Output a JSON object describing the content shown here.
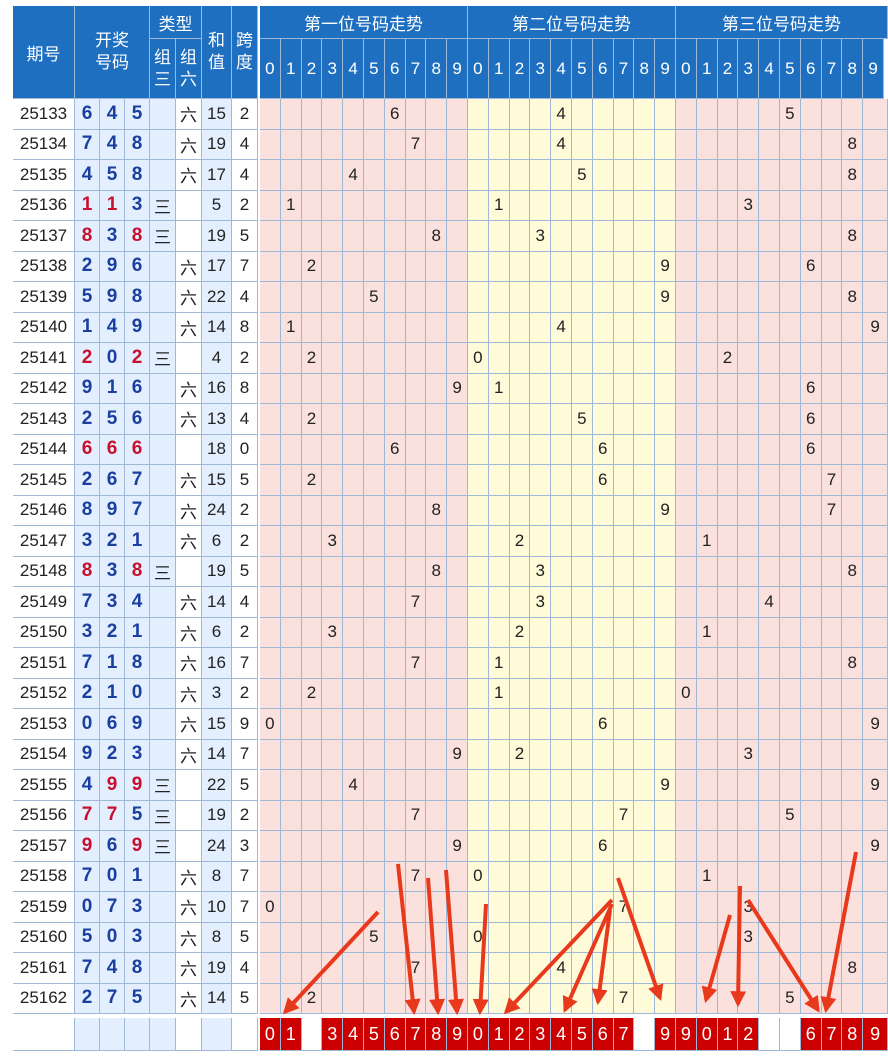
{
  "header": {
    "issue": "期号",
    "win_line1": "开奖",
    "win_line2": "号码",
    "type": "类型",
    "type_zu3_1": "组",
    "type_zu3_2": "三",
    "type_zu6_1": "组",
    "type_zu6_2": "六",
    "sum_1": "和",
    "sum_2": "值",
    "span_1": "跨",
    "span_2": "度",
    "pos1": "第一位号码走势",
    "pos2": "第二位号码走势",
    "pos3": "第三位号码走势",
    "digits": [
      "0",
      "1",
      "2",
      "3",
      "4",
      "5",
      "6",
      "7",
      "8",
      "9"
    ]
  },
  "colors": {
    "header_blue": "#1e6fbf",
    "number_blue": "#1b3fa0",
    "number_red": "#c8102e",
    "zone_pink": "#fbe1dd",
    "zone_yellow": "#fffbd9",
    "footer_red": "#cc0000",
    "arrow_red": "#e8391d"
  },
  "chart_data": {
    "type": "table",
    "columns": [
      "期号",
      "开奖号码",
      "组三",
      "组六",
      "和值",
      "跨度"
    ],
    "rows": [
      {
        "issue": "25133",
        "nums": [
          6,
          4,
          5
        ],
        "z3": "",
        "z6": "六",
        "sum": 15,
        "span": 2
      },
      {
        "issue": "25134",
        "nums": [
          7,
          4,
          8
        ],
        "z3": "",
        "z6": "六",
        "sum": 19,
        "span": 4
      },
      {
        "issue": "25135",
        "nums": [
          4,
          5,
          8
        ],
        "z3": "",
        "z6": "六",
        "sum": 17,
        "span": 4
      },
      {
        "issue": "25136",
        "nums": [
          1,
          1,
          3
        ],
        "z3": "三",
        "z6": "",
        "sum": 5,
        "span": 2
      },
      {
        "issue": "25137",
        "nums": [
          8,
          3,
          8
        ],
        "z3": "三",
        "z6": "",
        "sum": 19,
        "span": 5
      },
      {
        "issue": "25138",
        "nums": [
          2,
          9,
          6
        ],
        "z3": "",
        "z6": "六",
        "sum": 17,
        "span": 7
      },
      {
        "issue": "25139",
        "nums": [
          5,
          9,
          8
        ],
        "z3": "",
        "z6": "六",
        "sum": 22,
        "span": 4
      },
      {
        "issue": "25140",
        "nums": [
          1,
          4,
          9
        ],
        "z3": "",
        "z6": "六",
        "sum": 14,
        "span": 8
      },
      {
        "issue": "25141",
        "nums": [
          2,
          0,
          2
        ],
        "z3": "三",
        "z6": "",
        "sum": 4,
        "span": 2
      },
      {
        "issue": "25142",
        "nums": [
          9,
          1,
          6
        ],
        "z3": "",
        "z6": "六",
        "sum": 16,
        "span": 8
      },
      {
        "issue": "25143",
        "nums": [
          2,
          5,
          6
        ],
        "z3": "",
        "z6": "六",
        "sum": 13,
        "span": 4
      },
      {
        "issue": "25144",
        "nums": [
          6,
          6,
          6
        ],
        "z3": "",
        "z6": "",
        "sum": 18,
        "span": 0
      },
      {
        "issue": "25145",
        "nums": [
          2,
          6,
          7
        ],
        "z3": "",
        "z6": "六",
        "sum": 15,
        "span": 5
      },
      {
        "issue": "25146",
        "nums": [
          8,
          9,
          7
        ],
        "z3": "",
        "z6": "六",
        "sum": 24,
        "span": 2
      },
      {
        "issue": "25147",
        "nums": [
          3,
          2,
          1
        ],
        "z3": "",
        "z6": "六",
        "sum": 6,
        "span": 2
      },
      {
        "issue": "25148",
        "nums": [
          8,
          3,
          8
        ],
        "z3": "三",
        "z6": "",
        "sum": 19,
        "span": 5
      },
      {
        "issue": "25149",
        "nums": [
          7,
          3,
          4
        ],
        "z3": "",
        "z6": "六",
        "sum": 14,
        "span": 4
      },
      {
        "issue": "25150",
        "nums": [
          3,
          2,
          1
        ],
        "z3": "",
        "z6": "六",
        "sum": 6,
        "span": 2
      },
      {
        "issue": "25151",
        "nums": [
          7,
          1,
          8
        ],
        "z3": "",
        "z6": "六",
        "sum": 16,
        "span": 7
      },
      {
        "issue": "25152",
        "nums": [
          2,
          1,
          0
        ],
        "z3": "",
        "z6": "六",
        "sum": 3,
        "span": 2
      },
      {
        "issue": "25153",
        "nums": [
          0,
          6,
          9
        ],
        "z3": "",
        "z6": "六",
        "sum": 15,
        "span": 9
      },
      {
        "issue": "25154",
        "nums": [
          9,
          2,
          3
        ],
        "z3": "",
        "z6": "六",
        "sum": 14,
        "span": 7
      },
      {
        "issue": "25155",
        "nums": [
          4,
          9,
          9
        ],
        "z3": "三",
        "z6": "",
        "sum": 22,
        "span": 5
      },
      {
        "issue": "25156",
        "nums": [
          7,
          7,
          5
        ],
        "z3": "三",
        "z6": "",
        "sum": 19,
        "span": 2
      },
      {
        "issue": "25157",
        "nums": [
          9,
          6,
          9
        ],
        "z3": "三",
        "z6": "",
        "sum": 24,
        "span": 3
      },
      {
        "issue": "25158",
        "nums": [
          7,
          0,
          1
        ],
        "z3": "",
        "z6": "六",
        "sum": 8,
        "span": 7
      },
      {
        "issue": "25159",
        "nums": [
          0,
          7,
          3
        ],
        "z3": "",
        "z6": "六",
        "sum": 10,
        "span": 7
      },
      {
        "issue": "25160",
        "nums": [
          5,
          0,
          3
        ],
        "z3": "",
        "z6": "六",
        "sum": 8,
        "span": 5
      },
      {
        "issue": "25161",
        "nums": [
          7,
          4,
          8
        ],
        "z3": "",
        "z6": "六",
        "sum": 19,
        "span": 4
      },
      {
        "issue": "25162",
        "nums": [
          2,
          7,
          5
        ],
        "z3": "",
        "z6": "六",
        "sum": 14,
        "span": 5
      }
    ],
    "footer_picks": {
      "pos1": [
        0,
        1,
        3,
        4,
        5,
        6,
        7,
        8,
        9
      ],
      "pos2": [
        0,
        1,
        2,
        3,
        4,
        5,
        6,
        7,
        9
      ],
      "pos3": [
        9,
        0,
        1,
        2,
        6,
        7,
        8,
        9
      ]
    }
  }
}
